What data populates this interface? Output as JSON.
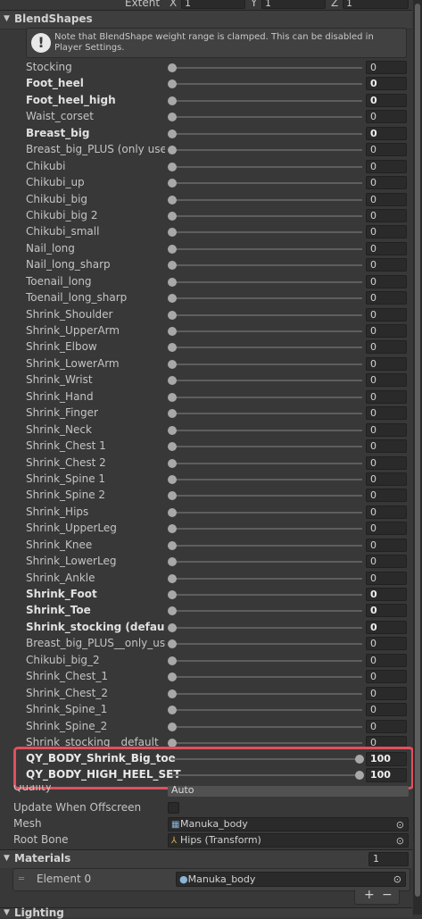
{
  "top": {
    "extent_label": "Extent",
    "x_label": "X",
    "x_value": "1",
    "y_label": "Y",
    "y_value": "1",
    "z_label": "Z",
    "z_value": "1"
  },
  "section_title": "BlendShapes",
  "info_message": "Note that BlendShape weight range is clamped. This can be disabled in Player Settings.",
  "blendshapes": [
    {
      "name": "Stocking",
      "value": "0",
      "bold": false
    },
    {
      "name": "Foot_heel",
      "value": "0",
      "bold": true
    },
    {
      "name": "Foot_heel_high",
      "value": "0",
      "bold": true
    },
    {
      "name": "Waist_corset",
      "value": "0",
      "bold": false
    },
    {
      "name": "Breast_big",
      "value": "0",
      "bold": true
    },
    {
      "name": "Breast_big_PLUS (only used w",
      "value": "0",
      "bold": false
    },
    {
      "name": "Chikubi",
      "value": "0",
      "bold": false
    },
    {
      "name": "Chikubi_up",
      "value": "0",
      "bold": false
    },
    {
      "name": "Chikubi_big",
      "value": "0",
      "bold": false
    },
    {
      "name": "Chikubi_big 2",
      "value": "0",
      "bold": false
    },
    {
      "name": "Chikubi_small",
      "value": "0",
      "bold": false
    },
    {
      "name": "Nail_long",
      "value": "0",
      "bold": false
    },
    {
      "name": "Nail_long_sharp",
      "value": "0",
      "bold": false
    },
    {
      "name": "Toenail_long",
      "value": "0",
      "bold": false
    },
    {
      "name": "Toenail_long_sharp",
      "value": "0",
      "bold": false
    },
    {
      "name": "Shrink_Shoulder",
      "value": "0",
      "bold": false
    },
    {
      "name": "Shrink_UpperArm",
      "value": "0",
      "bold": false
    },
    {
      "name": "Shrink_Elbow",
      "value": "0",
      "bold": false
    },
    {
      "name": "Shrink_LowerArm",
      "value": "0",
      "bold": false
    },
    {
      "name": "Shrink_Wrist",
      "value": "0",
      "bold": false
    },
    {
      "name": "Shrink_Hand",
      "value": "0",
      "bold": false
    },
    {
      "name": "Shrink_Finger",
      "value": "0",
      "bold": false
    },
    {
      "name": "Shrink_Neck",
      "value": "0",
      "bold": false
    },
    {
      "name": "Shrink_Chest 1",
      "value": "0",
      "bold": false
    },
    {
      "name": "Shrink_Chest 2",
      "value": "0",
      "bold": false
    },
    {
      "name": "Shrink_Spine 1",
      "value": "0",
      "bold": false
    },
    {
      "name": "Shrink_Spine 2",
      "value": "0",
      "bold": false
    },
    {
      "name": "Shrink_Hips",
      "value": "0",
      "bold": false
    },
    {
      "name": "Shrink_UpperLeg",
      "value": "0",
      "bold": false
    },
    {
      "name": "Shrink_Knee",
      "value": "0",
      "bold": false
    },
    {
      "name": "Shrink_LowerLeg",
      "value": "0",
      "bold": false
    },
    {
      "name": "Shrink_Ankle",
      "value": "0",
      "bold": false
    },
    {
      "name": "Shrink_Foot",
      "value": "0",
      "bold": true
    },
    {
      "name": "Shrink_Toe",
      "value": "0",
      "bold": true
    },
    {
      "name": "Shrink_stocking (default)",
      "value": "0",
      "bold": true
    },
    {
      "name": "Breast_big_PLUS__only_used_",
      "value": "0",
      "bold": false
    },
    {
      "name": "Chikubi_big_2",
      "value": "0",
      "bold": false
    },
    {
      "name": "Shrink_Chest_1",
      "value": "0",
      "bold": false
    },
    {
      "name": "Shrink_Chest_2",
      "value": "0",
      "bold": false
    },
    {
      "name": "Shrink_Spine_1",
      "value": "0",
      "bold": false
    },
    {
      "name": "Shrink_Spine_2",
      "value": "0",
      "bold": false
    },
    {
      "name": "Shrink_stocking__default_",
      "value": "0",
      "bold": false
    }
  ],
  "highlighted": [
    {
      "name": "QY_BODY_Shrink_Big_toe",
      "value": "100"
    },
    {
      "name": "QY_BODY_HIGH_HEEL_SET",
      "value": "100"
    }
  ],
  "quality": {
    "label": "Quality",
    "value": "Auto"
  },
  "update_offscreen": {
    "label": "Update When Offscreen"
  },
  "mesh": {
    "label": "Mesh",
    "value": "Manuka_body"
  },
  "root_bone": {
    "label": "Root Bone",
    "value": "Hips (Transform)"
  },
  "materials": {
    "title": "Materials",
    "count": "1",
    "element_label": "Element 0",
    "element_value": "Manuka_body"
  },
  "lighting_title": "Lighting",
  "colors": {
    "highlight_border": "#e0505e",
    "background": "#383838",
    "field": "#2a2a2a"
  }
}
